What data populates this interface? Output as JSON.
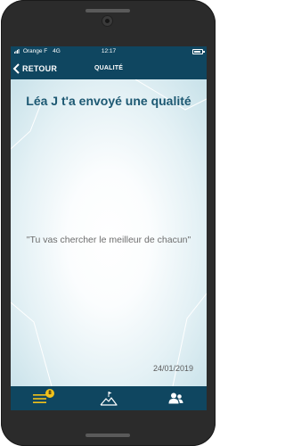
{
  "status_bar": {
    "carrier": "Orange F",
    "network": "4G",
    "time": "12:17"
  },
  "nav": {
    "back_label": "RETOUR",
    "title": "QUALITÉ"
  },
  "message": {
    "headline": "Léa J t'a envoyé une qualité",
    "quote": "\"Tu vas chercher le meilleur de chacun\"",
    "date": "24/01/2019"
  },
  "tab_bar": {
    "menu_badge_count": "8",
    "tabs": [
      {
        "icon": "hamburger-menu-icon"
      },
      {
        "icon": "mountain-flag-icon"
      },
      {
        "icon": "team-people-icon"
      }
    ]
  },
  "colors": {
    "primary": "#0f4660",
    "headline": "#1c5872",
    "badge": "#f2c21a"
  }
}
